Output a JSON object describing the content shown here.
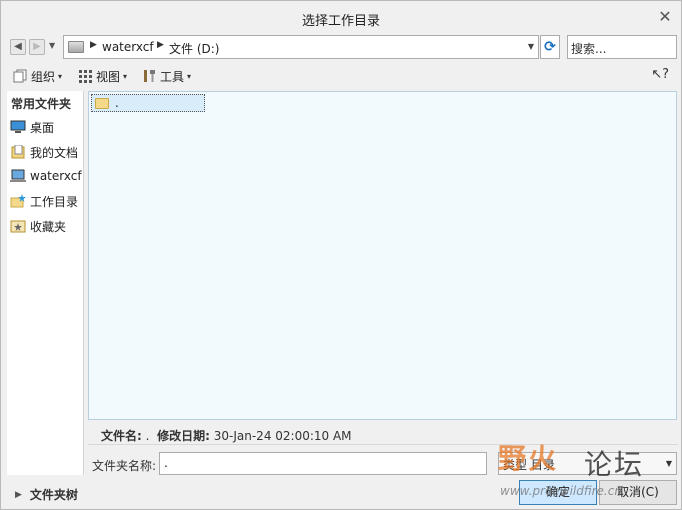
{
  "window": {
    "title": "选择工作目录",
    "close_glyph": "✕"
  },
  "nav": {
    "back_glyph": "◀",
    "forward_glyph": "▶",
    "dropdown_glyph": "▼",
    "breadcrumbs": [
      "waterxcf",
      "文件 (D:)"
    ],
    "sep_glyph": "▶",
    "address_dropdown_glyph": "▼",
    "refresh_glyph": "⟳",
    "search_placeholder": "搜索..."
  },
  "toolbar": {
    "organize": "组织",
    "view": "视图",
    "tools": "工具",
    "caret": "▾",
    "help_glyph": "↖?"
  },
  "sidebar": {
    "header": "常用文件夹",
    "items": [
      {
        "label": "桌面",
        "icon": "desktop-icon"
      },
      {
        "label": "我的文档",
        "icon": "documents-icon"
      },
      {
        "label": "waterxcf",
        "icon": "computer-icon"
      },
      {
        "label": "工作目录",
        "icon": "working-directory-icon"
      },
      {
        "label": "收藏夹",
        "icon": "favorites-icon"
      }
    ]
  },
  "files": [
    {
      "name": ".",
      "icon": "folder-icon",
      "selected": true
    }
  ],
  "details": {
    "filename_label": "文件名:",
    "filename_value": ".",
    "modified_label": "修改日期:",
    "modified_value": "30-Jan-24 02:00:10 AM"
  },
  "folder_name": {
    "label": "文件夹名称:",
    "value": "."
  },
  "type_select": {
    "value": "类型 目录",
    "caret": "▼"
  },
  "folder_tree": {
    "toggle_glyph": "▶",
    "label": "文件夹树"
  },
  "buttons": {
    "ok": "确定",
    "cancel": "取消(C)"
  },
  "watermark": {
    "text1": "野火",
    "text2": "论坛",
    "url": "www.proewildfire.cn"
  },
  "colors": {
    "file_area_bg": "#f3fafd",
    "selection_bg": "#d9ecfa",
    "primary_button": "#cde8ff",
    "watermark_orange": "#e67828"
  }
}
